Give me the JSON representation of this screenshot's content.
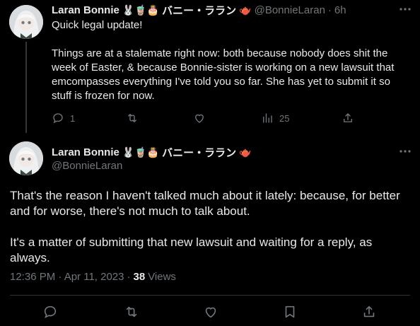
{
  "tweet1": {
    "author_name": "Laran Bonnie",
    "author_emoji": "🐰🧋🎂",
    "author_jp": "バニー・ララン",
    "author_jp_emoji": "🫖",
    "handle": "@BonnieLaran",
    "separator": "·",
    "time": "6h",
    "text": "Quick legal update!\n\nThings are at a stalemate right now: both because nobody does shit the week of Easter, & because Bonnie-sister is working on a new lawsuit that emcompasses everything I've told you so far. She has yet to submit it so stuff is frozen for now.",
    "reply_count": "1",
    "retweet_count": "",
    "like_count": "",
    "views_count": "25"
  },
  "tweet2": {
    "author_name": "Laran Bonnie",
    "author_emoji": "🐰🧋🎂",
    "author_jp": "バニー・ララン",
    "author_jp_emoji": "🫖",
    "handle": "@BonnieLaran",
    "text": "That's the reason I haven't talked much about it lately: because, for better and for worse, there's not much to talk about.\n\nIt's a matter of submitting that new lawsuit and waiting for a reply, as always.",
    "timestamp": "12:36 PM · Apr 11, 2023",
    "separator": "·",
    "views_number": "38",
    "views_label": "Views"
  },
  "icons": [
    "more-icon",
    "reply-icon",
    "retweet-icon",
    "like-icon",
    "views-icon",
    "share-icon",
    "bookmark-icon"
  ],
  "colors": {
    "background": "#000000",
    "text": "#e7e9ea",
    "muted": "#71767b",
    "divider": "#2f3336"
  }
}
